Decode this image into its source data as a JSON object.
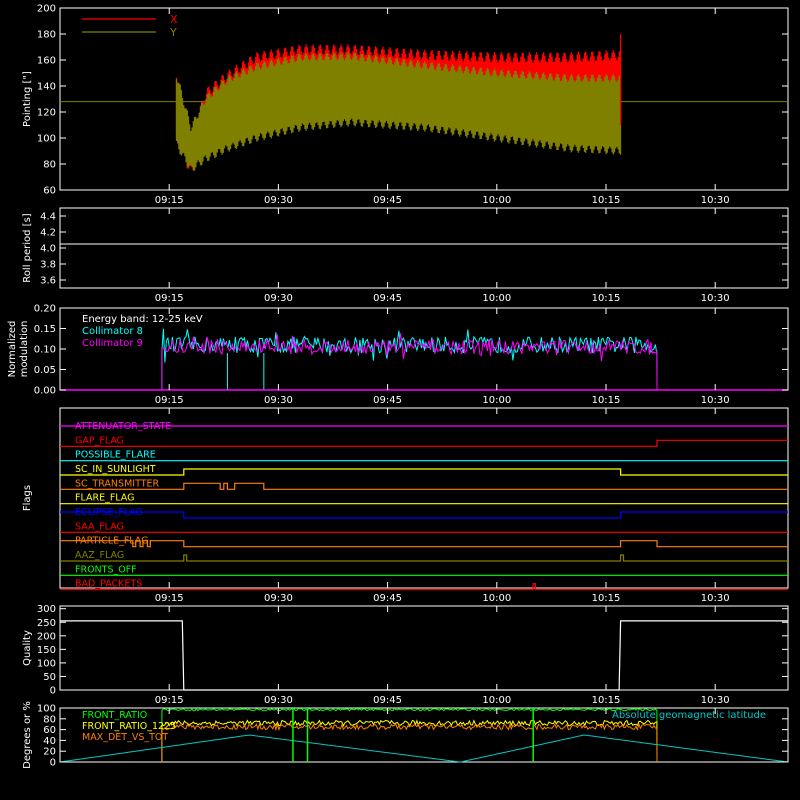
{
  "chart_data": [
    {
      "type": "line",
      "ylabel": "Pointing [\"]",
      "ylim": [
        60,
        200
      ],
      "yticks": [
        60,
        80,
        100,
        120,
        140,
        160,
        180,
        200
      ],
      "xticks": [
        "09:15",
        "09:30",
        "09:45",
        "10:00",
        "10:15",
        "10:30"
      ],
      "legend": "top-left",
      "series": [
        {
          "name": "X",
          "color": "#ff0000",
          "upper": [
            {
              "t": "09:16",
              "v": 150
            },
            {
              "t": "09:18",
              "v": 100
            },
            {
              "t": "09:20",
              "v": 134
            },
            {
              "t": "09:23",
              "v": 148
            },
            {
              "t": "09:27",
              "v": 162
            },
            {
              "t": "09:33",
              "v": 168
            },
            {
              "t": "09:40",
              "v": 168
            },
            {
              "t": "09:50",
              "v": 164
            },
            {
              "t": "10:00",
              "v": 162
            },
            {
              "t": "10:10",
              "v": 162
            },
            {
              "t": "10:17",
              "v": 164
            }
          ],
          "lower": [
            {
              "t": "09:16",
              "v": 100
            },
            {
              "t": "09:18",
              "v": 74
            },
            {
              "t": "09:20",
              "v": 94
            },
            {
              "t": "09:23",
              "v": 108
            },
            {
              "t": "09:27",
              "v": 116
            },
            {
              "t": "09:33",
              "v": 122
            },
            {
              "t": "09:40",
              "v": 126
            },
            {
              "t": "09:50",
              "v": 124
            },
            {
              "t": "10:00",
              "v": 120
            },
            {
              "t": "10:10",
              "v": 118
            },
            {
              "t": "10:17",
              "v": 118
            }
          ]
        },
        {
          "name": "Y",
          "color": "#808000",
          "upper": [
            {
              "t": "09:16",
              "v": 148
            },
            {
              "t": "09:18",
              "v": 108
            },
            {
              "t": "09:20",
              "v": 130
            },
            {
              "t": "09:23",
              "v": 145
            },
            {
              "t": "09:27",
              "v": 155
            },
            {
              "t": "09:33",
              "v": 162
            },
            {
              "t": "09:40",
              "v": 163
            },
            {
              "t": "09:50",
              "v": 156
            },
            {
              "t": "10:00",
              "v": 150
            },
            {
              "t": "10:10",
              "v": 146
            },
            {
              "t": "10:17",
              "v": 146
            }
          ],
          "lower": [
            {
              "t": "09:16",
              "v": 95
            },
            {
              "t": "09:18",
              "v": 76
            },
            {
              "t": "09:20",
              "v": 84
            },
            {
              "t": "09:23",
              "v": 92
            },
            {
              "t": "09:27",
              "v": 100
            },
            {
              "t": "09:33",
              "v": 108
            },
            {
              "t": "09:40",
              "v": 112
            },
            {
              "t": "09:50",
              "v": 108
            },
            {
              "t": "10:00",
              "v": 100
            },
            {
              "t": "10:10",
              "v": 92
            },
            {
              "t": "10:17",
              "v": 90
            }
          ],
          "baseline": 128
        }
      ]
    },
    {
      "type": "line",
      "ylabel": "Roll period [s]",
      "ylim": [
        3.5,
        4.5
      ],
      "yticks": [
        3.6,
        3.8,
        4.0,
        4.2,
        4.4
      ],
      "yticklabels": [
        "3.6",
        "3.8",
        "4.0",
        "4.2",
        "4.4"
      ],
      "xticks": [
        "09:15",
        "09:30",
        "09:45",
        "10:00",
        "10:15",
        "10:30"
      ],
      "series": [
        {
          "color": "#ffffff",
          "values": [
            {
              "t": "09:00",
              "v": 4.05
            },
            {
              "t": "10:40",
              "v": 4.05
            }
          ]
        }
      ]
    },
    {
      "type": "line",
      "ylabel": "Normalized modulation",
      "ylim": [
        0.0,
        0.2
      ],
      "yticks": [
        0.0,
        0.05,
        0.1,
        0.15,
        0.2
      ],
      "yticklabels": [
        "0.00",
        "0.05",
        "0.10",
        "0.15",
        "0.20"
      ],
      "xticks": [
        "09:15",
        "09:30",
        "09:45",
        "10:00",
        "10:15",
        "10:30"
      ],
      "annotation": "Energy band: 12-25 keV",
      "series": [
        {
          "name": "Collimator 8",
          "color": "#00ffff",
          "start": "09:14",
          "end": "10:22",
          "mean": 0.11,
          "spread": 0.04,
          "gaps": [
            {
              "t": "09:23",
              "v": 0.0
            },
            {
              "t": "09:28",
              "v": 0.0
            }
          ]
        },
        {
          "name": "Collimator 9",
          "color": "#ff00ff",
          "start": "09:14",
          "end": "10:22",
          "mean": 0.105,
          "spread": 0.035
        }
      ]
    },
    {
      "type": "line",
      "ylabel": "Flags",
      "xticks": [
        "09:15",
        "09:30",
        "09:45",
        "10:00",
        "10:15",
        "10:30"
      ],
      "flags": [
        {
          "name": "ATTENUATOR_STATE",
          "color": "#ff00ff",
          "steps": [
            {
              "t": "09:00",
              "on": 1
            }
          ]
        },
        {
          "name": "GAP_FLAG",
          "color": "#ff0000",
          "steps": [
            {
              "t": "09:00",
              "on": 0
            },
            {
              "t": "10:22",
              "on": 1
            }
          ]
        },
        {
          "name": "POSSIBLE_FLARE",
          "color": "#00ffff",
          "steps": [
            {
              "t": "09:00",
              "on": 0
            }
          ]
        },
        {
          "name": "SC_IN_SUNLIGHT",
          "color": "#ffff00",
          "steps": [
            {
              "t": "09:00",
              "on": 0
            },
            {
              "t": "09:17",
              "on": 1
            },
            {
              "t": "10:17",
              "on": 0
            }
          ]
        },
        {
          "name": "SC_TRANSMITTER",
          "color": "#ff8000",
          "steps": [
            {
              "t": "09:00",
              "on": 0
            },
            {
              "t": "09:17",
              "on": 1
            },
            {
              "t": "09:22",
              "on": 0
            },
            {
              "t": "09:22.5",
              "on": 1
            },
            {
              "t": "09:23",
              "on": 0
            },
            {
              "t": "09:24",
              "on": 1
            },
            {
              "t": "09:28",
              "on": 0
            }
          ]
        },
        {
          "name": "FLARE_FLAG",
          "color": "#ffff00",
          "steps": [
            {
              "t": "09:00",
              "on": 0
            }
          ]
        },
        {
          "name": "ECLIPSE_FLAG",
          "color": "#0000ff",
          "steps": [
            {
              "t": "09:00",
              "on": 1
            },
            {
              "t": "09:17",
              "on": 0
            },
            {
              "t": "10:17",
              "on": 1
            }
          ]
        },
        {
          "name": "SAA_FLAG",
          "color": "#ff0000",
          "steps": [
            {
              "t": "09:00",
              "on": 0
            }
          ]
        },
        {
          "name": "PARTICLE_FLAG",
          "color": "#ff8000",
          "steps": [
            {
              "t": "09:00",
              "on": 1
            },
            {
              "t": "09:10",
              "on": 0
            },
            {
              "t": "09:10.4",
              "on": 1
            },
            {
              "t": "09:11",
              "on": 0
            },
            {
              "t": "09:11.4",
              "on": 1
            },
            {
              "t": "09:12",
              "on": 0
            },
            {
              "t": "09:12.4",
              "on": 1
            },
            {
              "t": "09:17",
              "on": 0
            },
            {
              "t": "10:17",
              "on": 1
            },
            {
              "t": "10:22",
              "on": 0
            }
          ]
        },
        {
          "name": "AAZ_FLAG",
          "color": "#808000",
          "steps": [
            {
              "t": "09:00",
              "on": 0
            },
            {
              "t": "09:17",
              "on": 1
            },
            {
              "t": "09:17.4",
              "on": 0
            },
            {
              "t": "10:17",
              "on": 1
            },
            {
              "t": "10:17.4",
              "on": 0
            }
          ]
        },
        {
          "name": "FRONTS_OFF",
          "color": "#00ff00",
          "steps": [
            {
              "t": "09:00",
              "on": 0
            }
          ]
        },
        {
          "name": "BAD_PACKETS",
          "color": "#ff0000",
          "steps": [
            {
              "t": "09:00",
              "on": 0
            },
            {
              "t": "10:05",
              "on": 1
            },
            {
              "t": "10:05.3",
              "on": 0
            }
          ]
        }
      ]
    },
    {
      "type": "line",
      "ylabel": "Quality",
      "ylim": [
        0,
        310
      ],
      "yticks": [
        0,
        50,
        100,
        150,
        200,
        250,
        300
      ],
      "xticks": [
        "09:15",
        "09:30",
        "09:45",
        "10:00",
        "10:15",
        "10:30"
      ],
      "series": [
        {
          "color": "#ffffff",
          "values": [
            {
              "t": "09:00",
              "v": 255
            },
            {
              "t": "09:16.8",
              "v": 255
            },
            {
              "t": "09:17",
              "v": 0
            },
            {
              "t": "10:16.8",
              "v": 0
            },
            {
              "t": "10:17",
              "v": 255
            },
            {
              "t": "10:40",
              "v": 255
            }
          ]
        }
      ]
    },
    {
      "type": "line",
      "ylabel": "Degrees or %",
      "ylim": [
        0,
        100
      ],
      "yticks": [
        0,
        20,
        40,
        60,
        80,
        100
      ],
      "xticks": [
        "09:15",
        "09:30",
        "09:45",
        "10:00",
        "10:15",
        "10:30"
      ],
      "annotation": "Absolute geomagnetic latitude",
      "series": [
        {
          "name": "FRONT_RATIO",
          "color": "#00ff00",
          "start": "09:14",
          "end": "10:22",
          "mean": 97,
          "spread": 4
        },
        {
          "name": "FRONT_RATIO_1225",
          "color": "#ffff00",
          "start": "09:14",
          "end": "10:22",
          "mean": 72,
          "spread": 10
        },
        {
          "name": "MAX_DET_VS_TOT",
          "color": "#ff8000",
          "start": "09:14",
          "end": "10:22",
          "mean": 65,
          "spread": 10
        },
        {
          "name": "Absolute geomagnetic latitude",
          "color": "#00c8c8",
          "peaks": [
            {
              "t": "09:00",
              "v": 0
            },
            {
              "t": "09:26",
              "v": 50
            },
            {
              "t": "09:55",
              "v": 0
            },
            {
              "t": "10:12",
              "v": 50
            },
            {
              "t": "10:40",
              "v": 0
            }
          ]
        }
      ]
    }
  ]
}
